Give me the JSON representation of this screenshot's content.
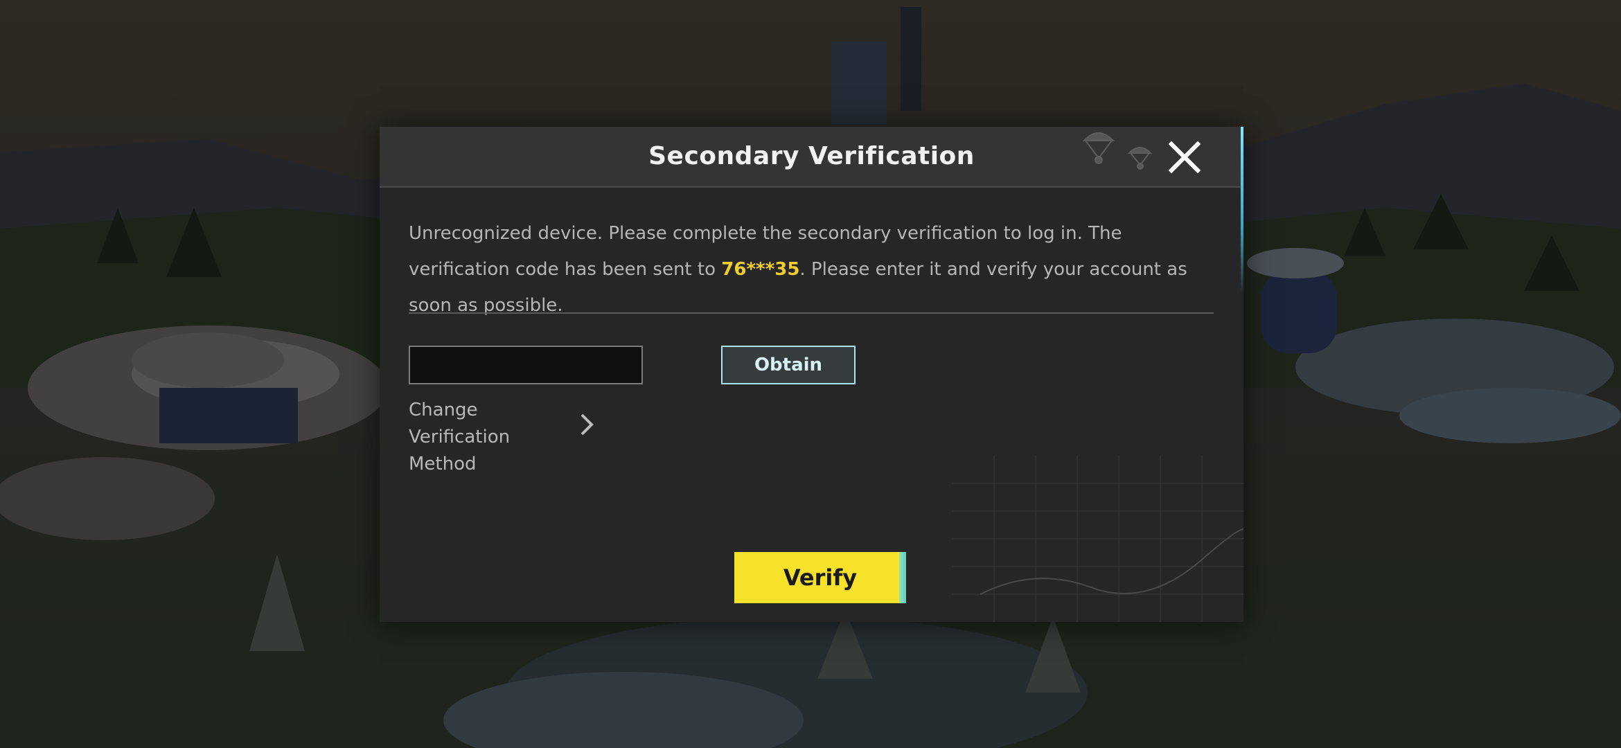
{
  "dialog": {
    "title": "Secondary Verification",
    "message_part1": "Unrecognized device. Please complete the secondary verification to log in. The verification code has been sent to ",
    "masked_phone": "76***35",
    "message_part2": ". Please enter it and verify your account as soon as possible.",
    "code_input": {
      "value": "",
      "placeholder": ""
    },
    "obtain_label": "Obtain",
    "change_method_label": "Change Verification Method",
    "verify_label": "Verify"
  },
  "colors": {
    "accent_yellow": "#f6e12b",
    "highlight_yellow": "#f2cd2b",
    "obtain_border": "#a9e8ee",
    "dialog_bg": "#262626"
  },
  "icons": {
    "close": "close-icon",
    "chevron": "chevron-right-icon"
  }
}
